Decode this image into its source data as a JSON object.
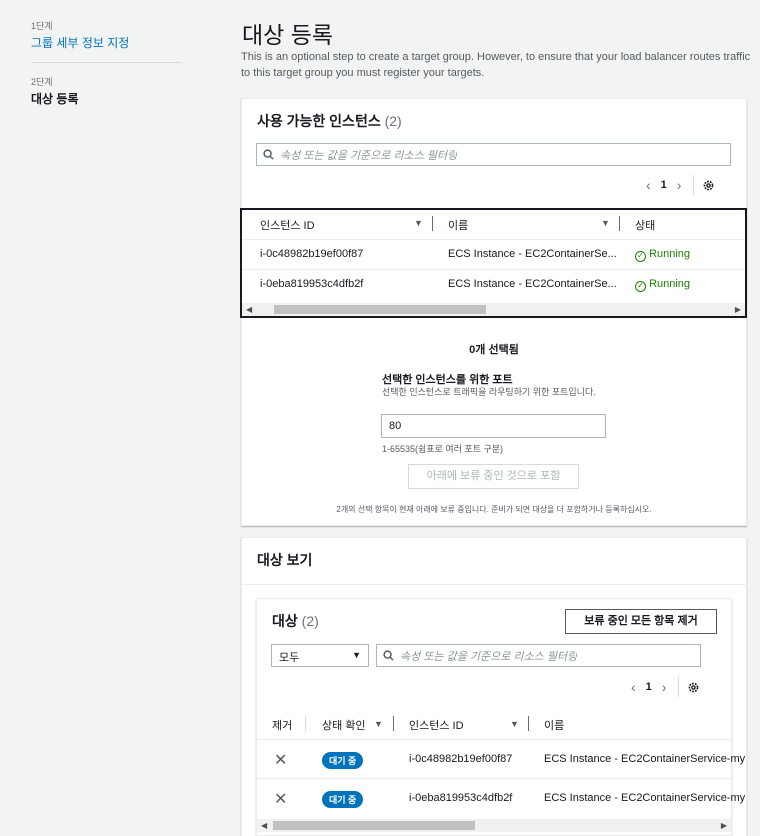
{
  "sidebar": {
    "steps": [
      {
        "num": "1단계",
        "label": "그룹 세부 정보 지정"
      },
      {
        "num": "2단계",
        "label": "대상 등록"
      }
    ]
  },
  "page": {
    "title": "대상 등록",
    "description": "This is an optional step to create a target group. However, to ensure that your load balancer routes traffic to this target group you must register your targets."
  },
  "available": {
    "title": "사용 가능한 인스턴스",
    "count": "(2)",
    "search_placeholder": "속성 또는 값을 기준으로 리소스 필터링",
    "page": "1",
    "columns": [
      "인스턴스 ID",
      "이름",
      "상태"
    ],
    "rows": [
      {
        "id": "i-0c48982b19ef00f87",
        "name": "ECS Instance - EC2ContainerSe...",
        "status": "Running"
      },
      {
        "id": "i-0eba819953c4dfb2f",
        "name": "ECS Instance - EC2ContainerSe...",
        "status": "Running"
      }
    ]
  },
  "selection": {
    "selected_text": "0개 선택됨",
    "port_label": "선택한 인스턴스를 위한 포트",
    "port_desc": "선택한 인스턴스로 트래픽을 라우팅하기 위한 포트입니다.",
    "port_value": "80",
    "port_hint": "1-65535(쉼표로 여러 포트 구분)",
    "include_button": "아래에 보류 중인 것으로 포함",
    "pending_note": "2개의 선택 항목이 현재 아래에 보류 중입니다. 준비가 되면 대상을 더 포함하거나 등록하십시오."
  },
  "review": {
    "title": "대상 보기",
    "targets_title": "대상",
    "targets_count": "(2)",
    "remove_all_button": "보류 중인 모든 항목 제거",
    "filter_value": "모두",
    "search_placeholder": "속성 또는 값을 기준으로 리소스 필터링",
    "page": "1",
    "columns": [
      "제거",
      "상태 확인",
      "인스턴스 ID",
      "이름"
    ],
    "rows": [
      {
        "badge": "대기 중",
        "id": "i-0c48982b19ef00f87",
        "name": "ECS Instance - EC2ContainerService-my"
      },
      {
        "badge": "대기 중",
        "id": "i-0eba819953c4dfb2f",
        "name": "ECS Instance - EC2ContainerService-my"
      }
    ]
  },
  "colors": {
    "accent": "#0073bb",
    "running": "#1d8102",
    "background": "#f2f3f3"
  }
}
